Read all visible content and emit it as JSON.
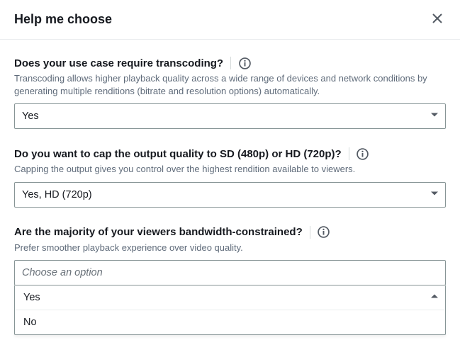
{
  "header": {
    "title": "Help me choose"
  },
  "fields": {
    "transcoding": {
      "label": "Does your use case require transcoding?",
      "help": "Transcoding allows higher playback quality across a wide range of devices and network conditions by generating multiple renditions (bitrate and resolution options) automatically.",
      "value": "Yes"
    },
    "cap": {
      "label": "Do you want to cap the output quality to SD (480p) or HD (720p)?",
      "help": "Capping the output gives you control over the highest rendition available to viewers.",
      "value": "Yes, HD (720p)"
    },
    "bandwidth": {
      "label": "Are the majority of your viewers bandwidth-constrained?",
      "help": "Prefer smoother playback experience over video quality.",
      "placeholder": "Choose an option",
      "options": {
        "0": "Yes",
        "1": "No"
      }
    }
  }
}
